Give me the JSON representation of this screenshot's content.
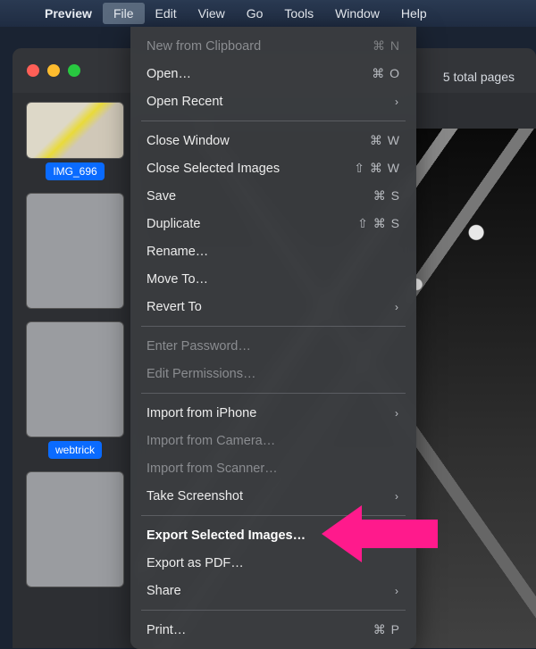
{
  "menubar": {
    "app_name": "Preview",
    "items": [
      "File",
      "Edit",
      "View",
      "Go",
      "Tools",
      "Window",
      "Help"
    ],
    "active_index": 0
  },
  "window": {
    "page_count": "5 total pages",
    "thumbnails": [
      {
        "label": "IMG_696"
      },
      {
        "label": ""
      },
      {
        "label": "webtrick"
      },
      {
        "label": ""
      }
    ]
  },
  "menu": {
    "groups": [
      [
        {
          "label": "New from Clipboard",
          "enabled": false,
          "shortcut": "⌘ N"
        },
        {
          "label": "Open…",
          "enabled": true,
          "shortcut": "⌘ O"
        },
        {
          "label": "Open Recent",
          "enabled": true,
          "submenu": true
        }
      ],
      [
        {
          "label": "Close Window",
          "enabled": true,
          "shortcut": "⌘ W"
        },
        {
          "label": "Close Selected Images",
          "enabled": true,
          "shortcut": "⇧ ⌘ W"
        },
        {
          "label": "Save",
          "enabled": true,
          "shortcut": "⌘ S"
        },
        {
          "label": "Duplicate",
          "enabled": true,
          "shortcut": "⇧ ⌘ S"
        },
        {
          "label": "Rename…",
          "enabled": true
        },
        {
          "label": "Move To…",
          "enabled": true
        },
        {
          "label": "Revert To",
          "enabled": true,
          "submenu": true
        }
      ],
      [
        {
          "label": "Enter Password…",
          "enabled": false
        },
        {
          "label": "Edit Permissions…",
          "enabled": false
        }
      ],
      [
        {
          "label": "Import from iPhone",
          "enabled": true,
          "submenu": true
        },
        {
          "label": "Import from Camera…",
          "enabled": false
        },
        {
          "label": "Import from Scanner…",
          "enabled": false
        },
        {
          "label": "Take Screenshot",
          "enabled": true,
          "submenu": true
        }
      ],
      [
        {
          "label": "Export Selected Images…",
          "enabled": true,
          "highlight": true
        },
        {
          "label": "Export as PDF…",
          "enabled": true
        },
        {
          "label": "Share",
          "enabled": true,
          "submenu": true
        }
      ],
      [
        {
          "label": "Print…",
          "enabled": true,
          "shortcut": "⌘ P"
        }
      ]
    ]
  }
}
